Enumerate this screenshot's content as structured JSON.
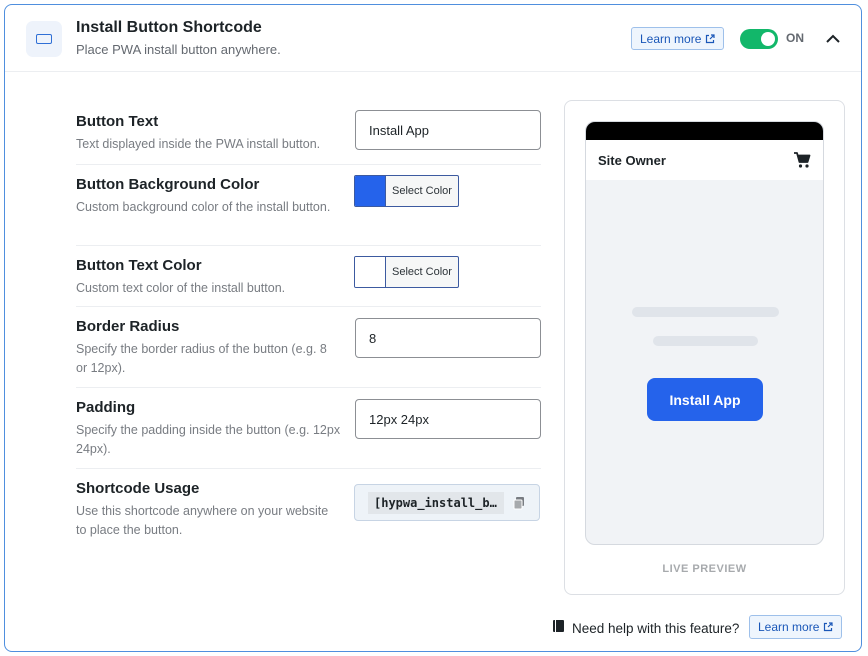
{
  "header": {
    "title": "Install Button Shortcode",
    "subtitle": "Place PWA install button anywhere.",
    "learn_more": "Learn more",
    "toggle_state": "ON"
  },
  "settings": {
    "button_text": {
      "label": "Button Text",
      "description": "Text displayed inside the PWA install button.",
      "value": "Install App"
    },
    "bg_color": {
      "label": "Button Background Color",
      "description": "Custom background color of the install button.",
      "button_label": "Select Color",
      "color": "#2563eb"
    },
    "text_color": {
      "label": "Button Text Color",
      "description": "Custom text color of the install button.",
      "button_label": "Select Color",
      "color": "#ffffff"
    },
    "border_radius": {
      "label": "Border Radius",
      "description": "Specify the border radius of the button (e.g. 8 or 12px).",
      "value": "8"
    },
    "padding": {
      "label": "Padding",
      "description": "Specify the padding inside the button (e.g. 12px 24px).",
      "value": "12px 24px"
    },
    "shortcode": {
      "label": "Shortcode Usage",
      "description": "Use this shortcode anywhere on your website to place the button.",
      "code": "[hypwa_install_button]"
    }
  },
  "preview": {
    "site_name": "Site Owner",
    "install_label": "Install App",
    "caption": "LIVE PREVIEW"
  },
  "footer": {
    "help_text": "Need help with this feature?",
    "learn_more": "Learn more"
  },
  "colors": {
    "accent": "#2563eb",
    "toggle_on": "#12b76a",
    "card_border": "#4f8fde"
  },
  "icons": {
    "feature": "button-outline-icon",
    "external": "external-link-icon",
    "collapse": "chevron-up-icon",
    "cart": "cart-icon",
    "copy": "copy-icon",
    "help": "book-icon"
  }
}
